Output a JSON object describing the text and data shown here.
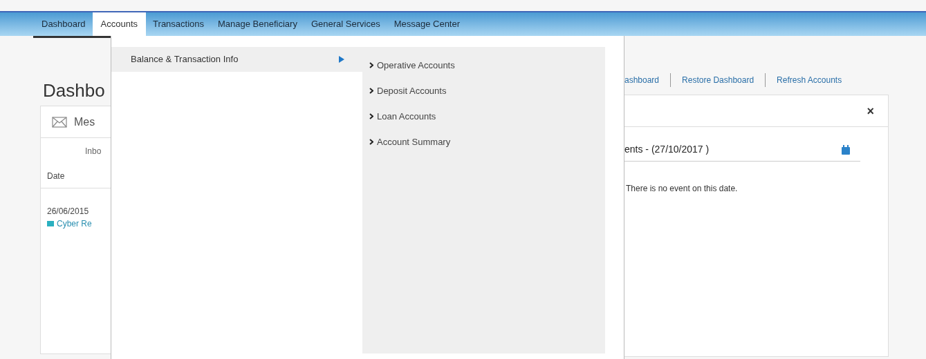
{
  "nav": {
    "tabs": [
      {
        "label": "Dashboard",
        "selected": false
      },
      {
        "label": "Accounts",
        "selected": true
      },
      {
        "label": "Transactions",
        "selected": false
      },
      {
        "label": "Manage Beneficiary",
        "selected": false
      },
      {
        "label": "General Services",
        "selected": false
      },
      {
        "label": "Message Center",
        "selected": false
      }
    ]
  },
  "menu": {
    "items": [
      {
        "label": "Balance & Transaction Info",
        "selected": true
      }
    ],
    "submenu": {
      "items": [
        {
          "label": "Operative Accounts"
        },
        {
          "label": "Deposit Accounts"
        },
        {
          "label": "Loan Accounts"
        },
        {
          "label": "Account Summary"
        }
      ]
    }
  },
  "page": {
    "title": "Dashbo",
    "links": [
      "ashboard",
      "Restore Dashboard",
      "Refresh Accounts"
    ]
  },
  "messages": {
    "title": "Mes",
    "tab": "Inbo",
    "column": "Date",
    "rows": [
      {
        "date": "26/06/2015",
        "subject": "Cyber Re"
      }
    ]
  },
  "events": {
    "close": "×",
    "heading": "ents - (27/10/2017 )",
    "empty": "There is no event on this date."
  }
}
